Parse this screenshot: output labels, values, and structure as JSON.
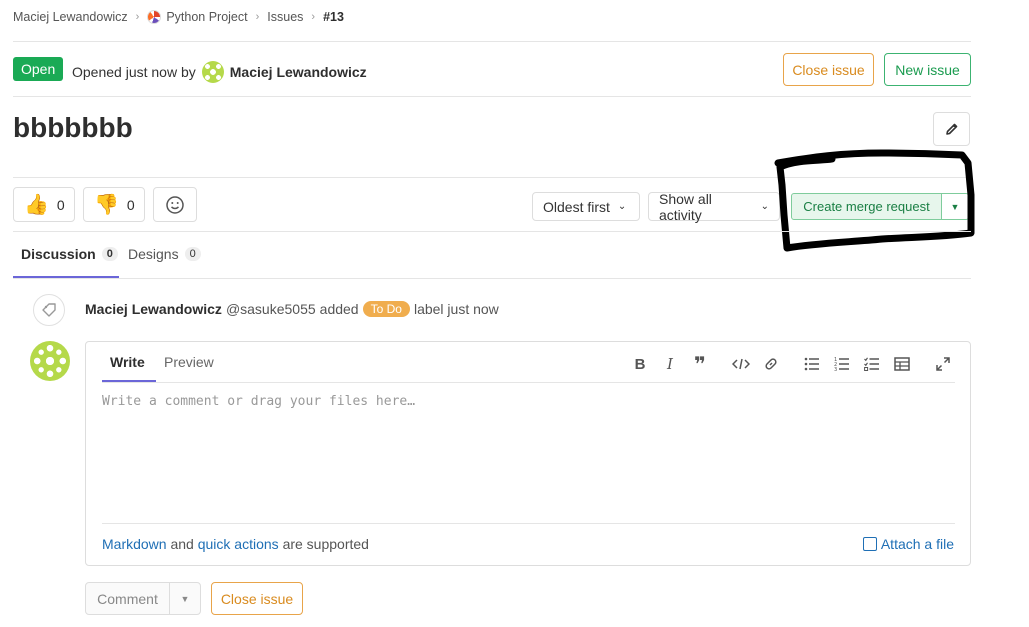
{
  "breadcrumb": {
    "user": "Maciej Lewandowicz",
    "project": "Python Project",
    "section": "Issues",
    "current": "#13"
  },
  "header": {
    "status": "Open",
    "opened_text": "Opened just now by",
    "author": "Maciej Lewandowicz",
    "close_issue_label": "Close issue",
    "new_issue_label": "New issue"
  },
  "issue": {
    "title": "bbbbbbb"
  },
  "awards": {
    "thumbs_up_count": "0",
    "thumbs_down_count": "0"
  },
  "controls": {
    "sort_label": "Oldest first",
    "filter_label": "Show all activity",
    "merge_request_label": "Create merge request"
  },
  "tabs": [
    {
      "label": "Discussion",
      "count": "0"
    },
    {
      "label": "Designs",
      "count": "0"
    }
  ],
  "system_note": {
    "author": "Maciej Lewandowicz",
    "username": "@sasuke5055",
    "action": "added",
    "label": "To Do",
    "suffix": "label just now"
  },
  "comment_box": {
    "write_tab": "Write",
    "preview_tab": "Preview",
    "placeholder": "Write a comment or drag your files here…",
    "markdown_link": "Markdown",
    "and_text": "and",
    "quick_actions_link": "quick actions",
    "supported_text": "are supported",
    "attach_label": "Attach a file"
  },
  "footer_buttons": {
    "comment_label": "Comment",
    "close_issue_label": "Close issue"
  },
  "colors": {
    "open_badge": "#1aaa55",
    "close_issue": "#d98b1f",
    "new_issue": "#1a9b4f",
    "tab_active": "#6b66d8",
    "label_todo": "#f0ad4e",
    "link": "#1f6fb5"
  }
}
